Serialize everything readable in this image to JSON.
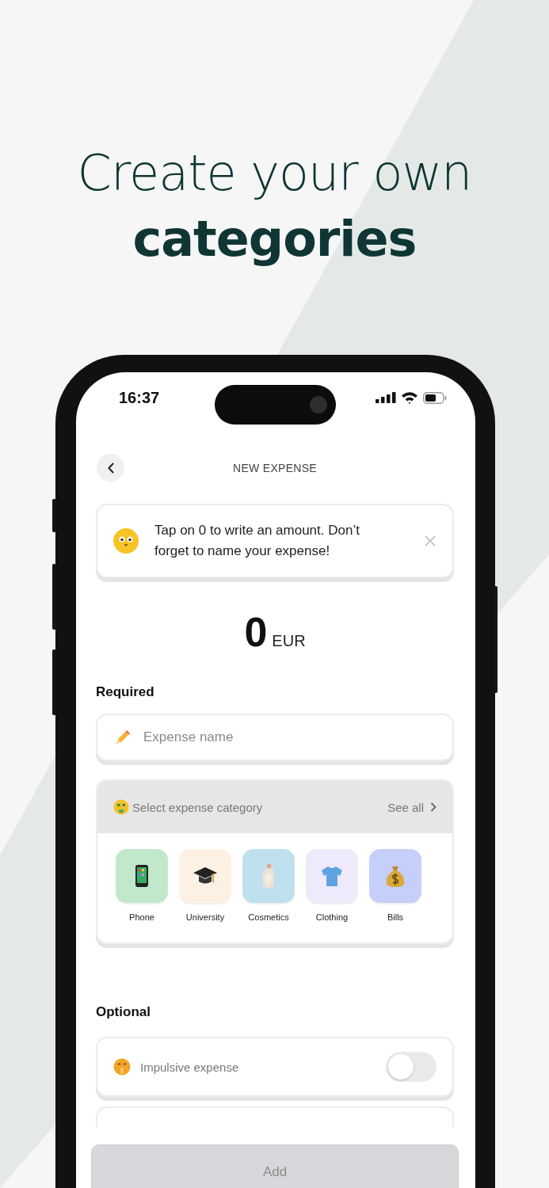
{
  "headline": {
    "line_1": "Create your own",
    "line_2": "categories"
  },
  "status_bar": {
    "time": "16:37"
  },
  "header": {
    "title": "NEW EXPENSE"
  },
  "tip": {
    "text": "Tap on 0 to write an amount. Don’t forget to name your expense!"
  },
  "amount": {
    "value": "0",
    "currency": "EUR"
  },
  "required": {
    "heading": "Required",
    "name_field": {
      "placeholder": "Expense name"
    },
    "category": {
      "label": "Select expense category",
      "see_all": "See all",
      "items": [
        {
          "label": "Phone",
          "color": "#c2e8cb"
        },
        {
          "label": "University",
          "color": "#fdf1e4"
        },
        {
          "label": "Cosmetics",
          "color": "#bfe0ee"
        },
        {
          "label": "Clothing",
          "color": "#efe9fc"
        },
        {
          "label": "Bills",
          "color": "#c6cffa"
        }
      ]
    }
  },
  "optional": {
    "heading": "Optional",
    "impulsive": {
      "label": "Impulsive expense",
      "on": false
    }
  },
  "add_button": {
    "label": "Add",
    "disabled": true
  }
}
